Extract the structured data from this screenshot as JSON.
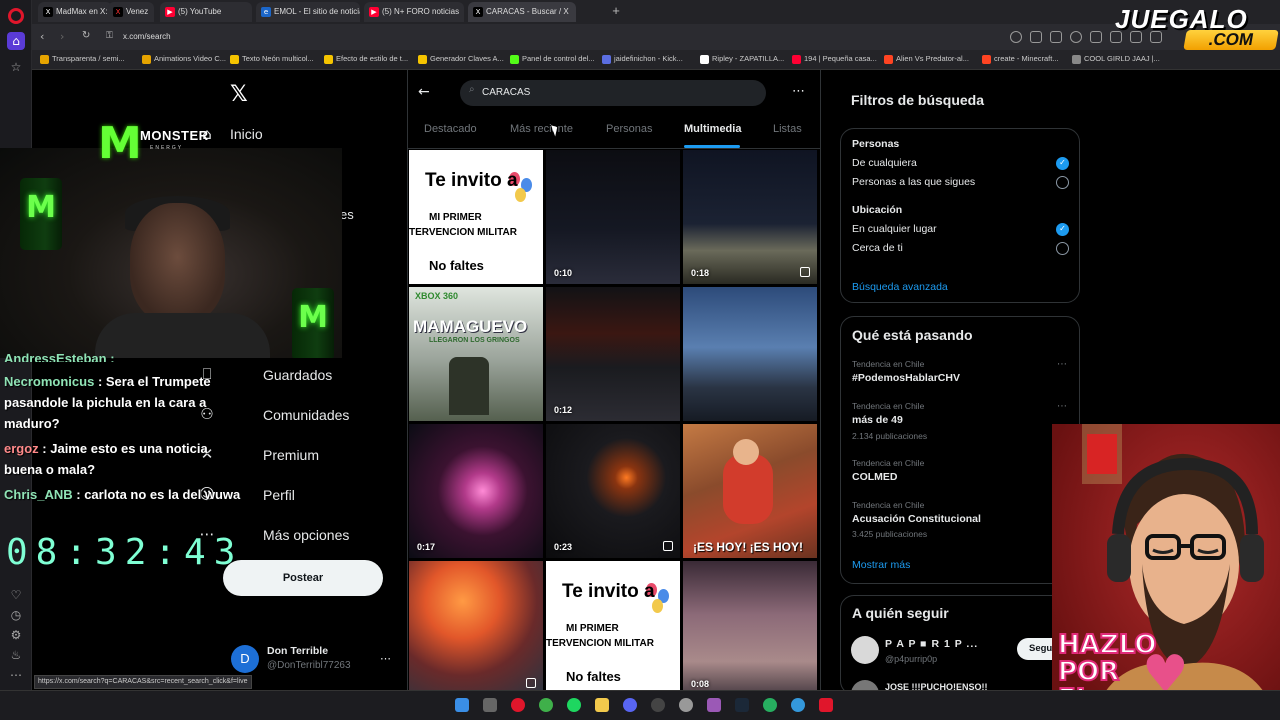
{
  "browser": {
    "tabs": [
      {
        "title": "MadMax en X: \"",
        "fav": "X",
        "color": "#000000"
      },
      {
        "title": "Venez",
        "fav": "X",
        "color": "#000000"
      },
      {
        "title": "(5) YouTube",
        "fav": "▶",
        "color": "#ff0033"
      },
      {
        "title": "EMOL - El sitio de noticias",
        "fav": "e",
        "color": "#1b66c9"
      },
      {
        "title": "(5) N+ FORO noticias",
        "fav": "▶",
        "color": "#ff0033"
      },
      {
        "title": "CARACAS - Buscar / X",
        "fav": "X",
        "color": "#000000"
      }
    ],
    "url": "x.com/search",
    "bookmarks": [
      {
        "label": "Transparenta / semi...",
        "color": "#e6a400"
      },
      {
        "label": "Animations Video C...",
        "color": "#e6a400"
      },
      {
        "label": "Texto Neón multicol...",
        "color": "#f5c400"
      },
      {
        "label": "Efecto de estilo de t...",
        "color": "#f5c400"
      },
      {
        "label": "Generador Claves A...",
        "color": "#f5c400"
      },
      {
        "label": "Panel de control del...",
        "color": "#53fc18"
      },
      {
        "label": "jaidefinichon - Kick...",
        "color": "#5b6ee1"
      },
      {
        "label": "Ripley - ZAPATILLA...",
        "color": "#ffffff"
      },
      {
        "label": "194 | Pequeña casa...",
        "color": "#ff0033"
      },
      {
        "label": "Alien Vs Predator-al...",
        "color": "#ff4422"
      },
      {
        "label": "create - Minecraft...",
        "color": "#ff4422"
      },
      {
        "label": "COOL GIRLD JAAJ |...",
        "color": "#888888"
      }
    ]
  },
  "overlay": {
    "logo_top": "JUEGALO",
    "logo_bottom": ".COM",
    "monster_title": "MONSTER",
    "monster_sub": "ENERGY",
    "clock": "08:32:43",
    "chat": [
      {
        "user": "AndressEsteban :",
        "text": ""
      },
      {
        "user": "Necromonicus",
        "text": ": Sera el Trumpete pasandole la pichula en la cara a maduro?"
      },
      {
        "user": "ergoz",
        "text": ": Jaime esto es una noticia buena o mala?"
      },
      {
        "user": "Chris_ANB",
        "text": ": carlota no es la del wuwa"
      }
    ],
    "hazlo": [
      "HAZLO",
      "POR",
      "EL"
    ]
  },
  "xnav": {
    "items": [
      {
        "label": "Inicio",
        "icon": "home-icon"
      },
      {
        "label": "es",
        "icon": "notifications-icon"
      },
      {
        "label": "Guardados",
        "icon": "bookmark-icon"
      },
      {
        "label": "Comunidades",
        "icon": "communities-icon"
      },
      {
        "label": "Premium",
        "icon": "x-icon"
      },
      {
        "label": "Perfil",
        "icon": "profile-icon"
      },
      {
        "label": "Más opciones",
        "icon": "more-icon"
      }
    ],
    "post_label": "Postear",
    "account_name": "Don Terrible",
    "account_handle": "@DonTerribl77263",
    "account_initial": "D"
  },
  "search": {
    "query": "CARACAS",
    "tabs": [
      "Destacado",
      "Más reciente",
      "Personas",
      "Multimedia",
      "Listas"
    ],
    "active_tab": "Multimedia",
    "tiles": [
      {
        "kind": "invite",
        "duration": ""
      },
      {
        "kind": "dark",
        "duration": "0:10"
      },
      {
        "kind": "city-night",
        "duration": "0:18",
        "multi": true
      },
      {
        "kind": "xbox",
        "duration": "",
        "title": "MAMAGUEVO",
        "sub": "LLEGARON LOS GRINGOS",
        "brand": "XBOX 360"
      },
      {
        "kind": "dark-red",
        "duration": "0:12"
      },
      {
        "kind": "city-dusk",
        "duration": ""
      },
      {
        "kind": "explosion",
        "duration": "0:17"
      },
      {
        "kind": "fire-night",
        "duration": "0:23",
        "multi": true
      },
      {
        "kind": "kid",
        "duration": "",
        "caption": "¡ES HOY! ¡ES HOY!"
      },
      {
        "kind": "fire-orange",
        "duration": "",
        "multi": true
      },
      {
        "kind": "invite",
        "duration": ""
      },
      {
        "kind": "pink-sky",
        "duration": "0:08"
      }
    ],
    "invite": {
      "line1": "Te invito a",
      "line2": "MI PRIMER",
      "line3": "TERVENCION MILITAR",
      "line4": "No faltes"
    }
  },
  "filters": {
    "title": "Filtros de búsqueda",
    "people_heading": "Personas",
    "people_options": [
      {
        "label": "De cualquiera",
        "checked": true
      },
      {
        "label": "Personas a las que sigues",
        "checked": false
      }
    ],
    "location_heading": "Ubicación",
    "location_options": [
      {
        "label": "En cualquier lugar",
        "checked": true
      },
      {
        "label": "Cerca de ti",
        "checked": false
      }
    ],
    "advanced": "Búsqueda avanzada"
  },
  "trends": {
    "title": "Qué está pasando",
    "items": [
      {
        "meta": "Tendencia en Chile",
        "name": "#PodemosHablarCHV",
        "count": ""
      },
      {
        "meta": "Tendencia en Chile",
        "name": "más de 49",
        "count": "2.134 publicaciones"
      },
      {
        "meta": "Tendencia en Chile",
        "name": "COLMED",
        "count": ""
      },
      {
        "meta": "Tendencia en Chile",
        "name": "Acusación Constitucional",
        "count": "3.425 publicaciones"
      }
    ],
    "show_more": "Mostrar más"
  },
  "follow": {
    "title": "A quién seguir",
    "items": [
      {
        "name": "P A P ■ R 1 P ...",
        "handle": "@p4purrip0p",
        "button": "Segu"
      },
      {
        "name": "JOSE !!!PUCHO!ENSO!!",
        "handle": "",
        "button": ""
      }
    ]
  },
  "status_url": "https://x.com/search?q=CARACAS&src=recent_search_click&f=live"
}
